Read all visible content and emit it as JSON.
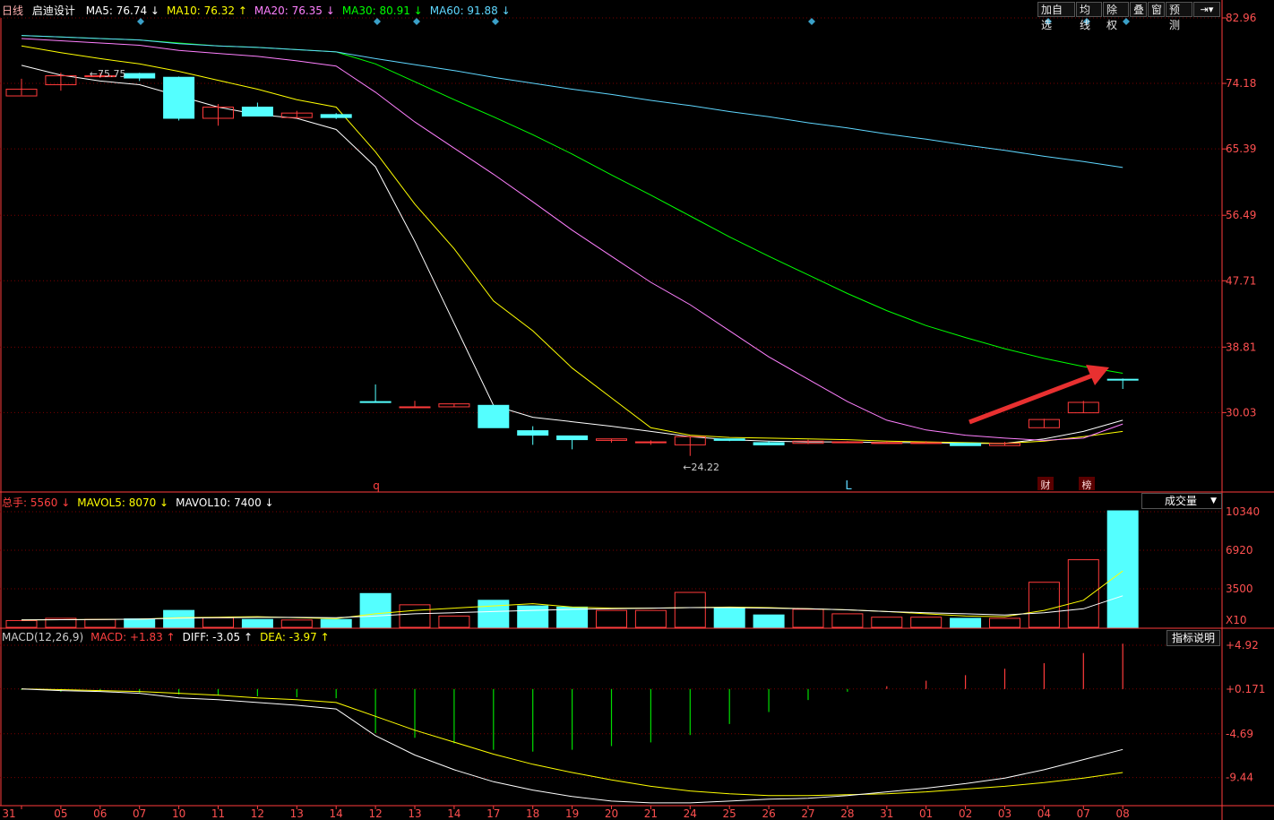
{
  "toolbar": {
    "period": "日线",
    "stock_name": "启迪设计",
    "buttons": [
      "加自选",
      "均线",
      "除权",
      "叠",
      "窗",
      "预测"
    ]
  },
  "ma_legend": [
    {
      "label": "MA5: 76.74",
      "arrow": "↓",
      "color": "#ffffff"
    },
    {
      "label": "MA10: 76.32",
      "arrow": "↑",
      "color": "#ffff00"
    },
    {
      "label": "MA20: 76.35",
      "arrow": "↓",
      "color": "#ff80ff"
    },
    {
      "label": "MA30: 80.91",
      "arrow": "↓",
      "color": "#00ff00"
    },
    {
      "label": "MA60: 91.88",
      "arrow": "↓",
      "color": "#5fd7ff"
    }
  ],
  "vol_legend": [
    {
      "label": "总手: 5560",
      "arrow": "↓",
      "color": "#ff4040"
    },
    {
      "label": "MAVOL5: 8070",
      "arrow": "↓",
      "color": "#ffff00"
    },
    {
      "label": "MAVOL10: 7400",
      "arrow": "↓",
      "color": "#ffffff"
    }
  ],
  "macd_legend": [
    {
      "label": "MACD(12,26,9)",
      "arrow": "",
      "color": "#cccccc"
    },
    {
      "label": "MACD: +1.83",
      "arrow": "↑",
      "color": "#ff4040"
    },
    {
      "label": "DIFF: -3.05",
      "arrow": "↑",
      "color": "#ffffff"
    },
    {
      "label": "DEA: -3.97",
      "arrow": "↑",
      "color": "#ffff00"
    }
  ],
  "vol_panel_button": "成交量",
  "macd_panel_button": "指标说明",
  "annotations": {
    "high": "75.75",
    "low": "24.22",
    "marker_q": "q",
    "marker_l": "L",
    "badge_cai": "财",
    "badge_bang": "榜"
  },
  "colors": {
    "up": "#ff3b3b",
    "down": "#54ffff",
    "ma5": "#ffffff",
    "ma10": "#ffff00",
    "ma20": "#ff80ff",
    "ma30": "#00ff00",
    "ma60": "#5fd7ff",
    "grid": "#7a0000",
    "axis": "#ff3b3b"
  },
  "chart_data": [
    {
      "type": "candlestick",
      "categories": [
        "31",
        "05",
        "06",
        "07",
        "10",
        "11",
        "12",
        "13",
        "14",
        "12",
        "13",
        "14",
        "17",
        "18",
        "19",
        "20",
        "21",
        "24",
        "25",
        "26",
        "27",
        "28",
        "31",
        "01",
        "02",
        "03",
        "04",
        "07",
        "08"
      ],
      "ohlc": [
        [
          72.5,
          73.4,
          74.8,
          72.6
        ],
        [
          74.0,
          75.2,
          75.6,
          73.2
        ],
        [
          75.2,
          75.2,
          75.6,
          74.9
        ],
        [
          75.5,
          74.9,
          75.6,
          74.5
        ],
        [
          75.0,
          69.5,
          75.1,
          69.2
        ],
        [
          69.5,
          71.0,
          71.4,
          68.5
        ],
        [
          71.0,
          69.8,
          71.6,
          69.8
        ],
        [
          69.6,
          70.2,
          70.5,
          69.5
        ],
        [
          70.0,
          69.6,
          70.2,
          69.4
        ],
        [
          31.5,
          31.4,
          33.8,
          31.5
        ],
        [
          30.7,
          30.8,
          31.6,
          30.7
        ],
        [
          30.8,
          31.2,
          31.2,
          30.8
        ],
        [
          31.0,
          28.0,
          31.1,
          28.0
        ],
        [
          27.6,
          27.0,
          28.2,
          25.7
        ],
        [
          26.9,
          26.4,
          26.9,
          25.1
        ],
        [
          26.3,
          26.5,
          26.5,
          26.0
        ],
        [
          26.0,
          26.1,
          26.3,
          25.7
        ],
        [
          25.7,
          26.8,
          26.9,
          24.22
        ],
        [
          26.5,
          26.3,
          26.5,
          26.2
        ],
        [
          26.0,
          25.7,
          26.2,
          25.7
        ],
        [
          25.9,
          26.2,
          26.4,
          25.8
        ],
        [
          26.0,
          26.1,
          26.2,
          26.0
        ],
        [
          26.0,
          26.0,
          26.2,
          25.9
        ],
        [
          26.0,
          26.0,
          26.2,
          25.9
        ],
        [
          25.9,
          25.6,
          26.0,
          25.6
        ],
        [
          25.6,
          25.9,
          26.1,
          25.6
        ],
        [
          28.0,
          29.1,
          29.2,
          28.0
        ],
        [
          30.0,
          31.4,
          31.6,
          30.0
        ],
        [
          34.5,
          34.4,
          34.6,
          33.2
        ]
      ],
      "ma": {
        "MA5": [
          76.6,
          75.3,
          74.5,
          74.0,
          72.5,
          71.0,
          70.0,
          69.5,
          68.0,
          63.0,
          53.0,
          42.0,
          31.0,
          29.4,
          28.8,
          28.2,
          27.5,
          26.8,
          26.4,
          26.2,
          26.1,
          26.1,
          26.0,
          26.0,
          25.9,
          25.9,
          26.5,
          27.5,
          29.0
        ],
        "MA10": [
          79.2,
          78.3,
          77.5,
          76.8,
          75.8,
          74.6,
          73.4,
          72.0,
          71.0,
          65.0,
          58.0,
          52.0,
          45.0,
          41.0,
          36.0,
          32.0,
          28.0,
          27.0,
          26.7,
          26.6,
          26.5,
          26.4,
          26.2,
          26.1,
          26.0,
          25.9,
          26.2,
          26.8,
          27.5
        ],
        "MA20": [
          80.2,
          79.9,
          79.6,
          79.3,
          78.6,
          78.2,
          77.8,
          77.2,
          76.5,
          73.0,
          69.0,
          65.5,
          62.0,
          58.3,
          54.5,
          51.0,
          47.5,
          44.5,
          41.0,
          37.5,
          34.5,
          31.5,
          29.0,
          27.7,
          27.0,
          26.6,
          26.3,
          26.6,
          28.5
        ],
        "MA30": [
          80.6,
          80.4,
          80.2,
          80.0,
          79.6,
          79.2,
          79.0,
          78.7,
          78.4,
          76.8,
          74.4,
          72.0,
          69.7,
          67.3,
          64.7,
          61.9,
          59.2,
          56.4,
          53.6,
          51.0,
          48.5,
          46.0,
          43.7,
          41.7,
          40.1,
          38.6,
          37.3,
          36.2,
          35.3
        ],
        "MA60": [
          80.6,
          80.4,
          80.2,
          80.0,
          79.5,
          79.2,
          79.0,
          78.7,
          78.4,
          77.5,
          76.7,
          75.9,
          75.0,
          74.2,
          73.4,
          72.7,
          71.9,
          71.2,
          70.4,
          69.7,
          68.9,
          68.2,
          67.4,
          66.7,
          65.9,
          65.2,
          64.4,
          63.7,
          62.9
        ]
      },
      "y_ticks": [
        82.96,
        74.18,
        65.39,
        56.49,
        47.71,
        38.81,
        30.03
      ],
      "ylim": [
        21.3,
        82.96
      ]
    },
    {
      "type": "bar",
      "title": "成交量",
      "volume": [
        600,
        800,
        700,
        750,
        1500,
        850,
        700,
        650,
        700,
        3000,
        2000,
        1000,
        2400,
        1900,
        1800,
        1500,
        1500,
        3100,
        1700,
        1100,
        1600,
        1200,
        900,
        900,
        800,
        800,
        4000,
        6000,
        10340
      ],
      "mavol5": [
        650,
        680,
        700,
        720,
        850,
        900,
        950,
        850,
        780,
        1200,
        1500,
        1700,
        1900,
        2100,
        1800,
        1700,
        1700,
        1750,
        1800,
        1750,
        1650,
        1550,
        1400,
        1200,
        1000,
        950,
        1500,
        2400,
        5000
      ],
      "mavol10": [
        650,
        680,
        700,
        720,
        800,
        850,
        880,
        880,
        860,
        1000,
        1200,
        1300,
        1400,
        1500,
        1600,
        1650,
        1700,
        1750,
        1750,
        1700,
        1650,
        1550,
        1400,
        1300,
        1200,
        1100,
        1300,
        1650,
        2800
      ],
      "y_ticks": [
        "10340",
        "6920",
        "3500",
        "X10"
      ],
      "ylim": [
        0,
        10340
      ]
    },
    {
      "type": "bar",
      "title": "MACD(12,26,9)",
      "macd": [
        -0.1,
        -0.3,
        -0.3,
        -0.4,
        -0.6,
        -0.7,
        -0.8,
        -0.9,
        -1.0,
        -4.8,
        -5.3,
        -5.9,
        -6.6,
        -6.8,
        -6.6,
        -6.2,
        -5.8,
        -5.0,
        -3.8,
        -2.5,
        -1.2,
        -0.3,
        0.3,
        0.9,
        1.5,
        2.2,
        2.8,
        3.9,
        4.92
      ],
      "diff": [
        0.171,
        0.0,
        -0.1,
        -0.3,
        -0.8,
        -1.0,
        -1.3,
        -1.6,
        -2.0,
        -4.9,
        -7.0,
        -8.6,
        -9.9,
        -10.8,
        -11.5,
        -12.0,
        -12.2,
        -12.2,
        -12.0,
        -11.8,
        -11.7,
        -11.4,
        -11.0,
        -10.6,
        -10.1,
        -9.5,
        -8.6,
        -7.5,
        -6.4
      ],
      "dea": [
        0.171,
        0.1,
        0.0,
        -0.1,
        -0.3,
        -0.5,
        -0.8,
        -1.0,
        -1.3,
        -2.8,
        -4.3,
        -5.6,
        -6.9,
        -8.0,
        -8.9,
        -9.7,
        -10.4,
        -10.9,
        -11.2,
        -11.4,
        -11.4,
        -11.3,
        -11.2,
        -11.0,
        -10.7,
        -10.4,
        -10.0,
        -9.5,
        -8.9
      ],
      "y_ticks": [
        4.92,
        0.171,
        -4.69,
        -9.44
      ],
      "ylim": [
        -12.4,
        4.92
      ]
    }
  ]
}
